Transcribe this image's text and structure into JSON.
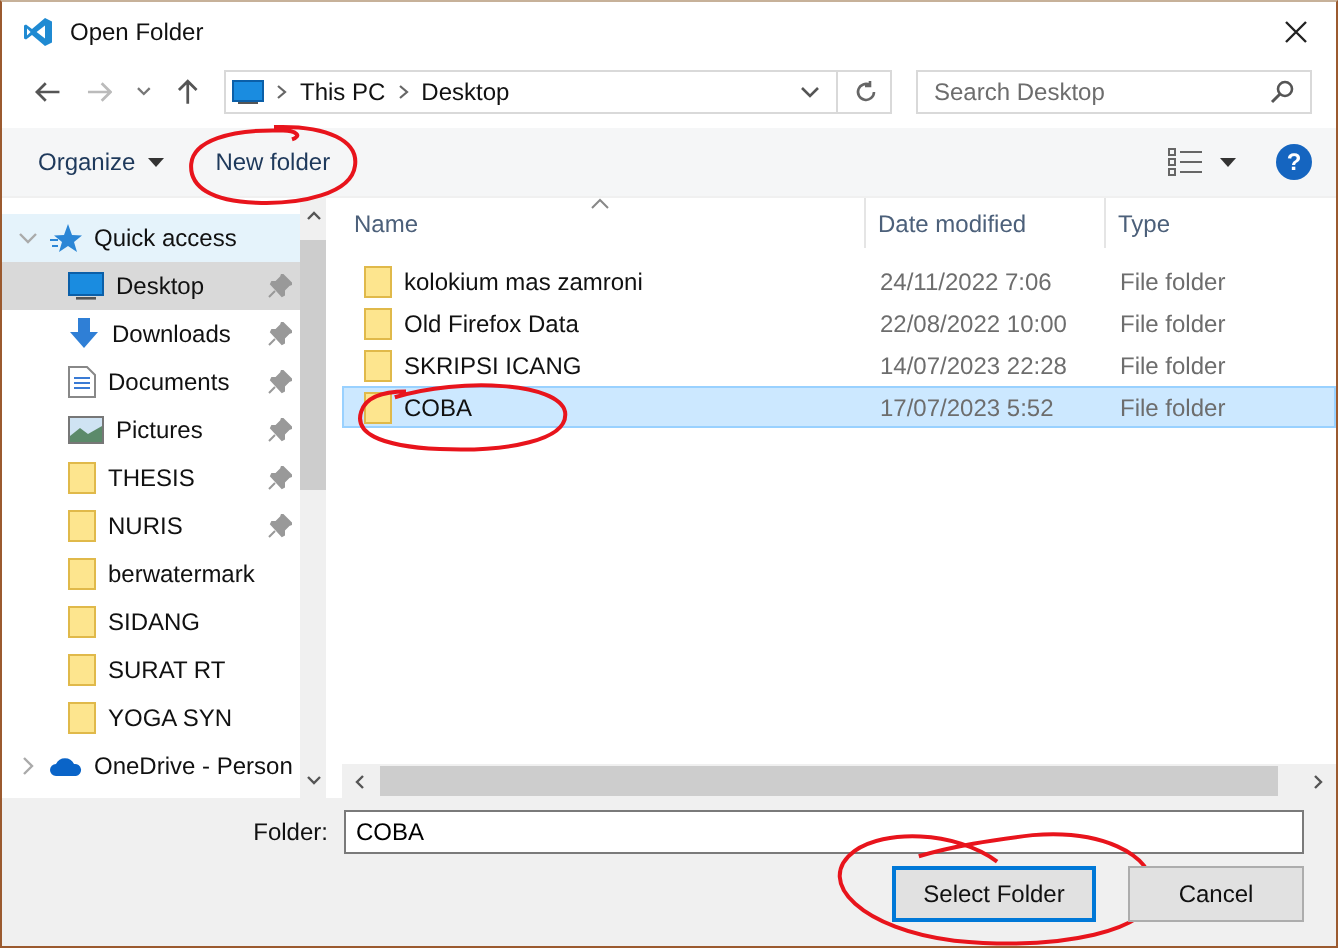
{
  "window": {
    "title": "Open Folder"
  },
  "nav": {
    "path": [
      "This PC",
      "Desktop"
    ],
    "search_placeholder": "Search Desktop"
  },
  "toolbar": {
    "organize": "Organize",
    "new_folder": {
      "label": "New folder",
      "circled": true
    },
    "help": "?"
  },
  "sidebar": [
    {
      "kind": "quick",
      "label": "Quick access",
      "expanded": true,
      "hovered": true,
      "children": [
        {
          "kind": "desktop",
          "label": "Desktop",
          "pinned": true,
          "selected": true
        },
        {
          "kind": "downloads",
          "label": "Downloads",
          "pinned": true,
          "selected": false
        },
        {
          "kind": "documents",
          "label": "Documents",
          "pinned": true,
          "selected": false
        },
        {
          "kind": "pictures",
          "label": "Pictures",
          "pinned": true,
          "selected": false
        },
        {
          "kind": "folder",
          "label": "THESIS",
          "pinned": true,
          "selected": false
        },
        {
          "kind": "folder",
          "label": "NURIS",
          "pinned": true,
          "selected": false
        },
        {
          "kind": "folder",
          "label": "berwatermark",
          "pinned": false,
          "selected": false
        },
        {
          "kind": "folder",
          "label": "SIDANG",
          "pinned": false,
          "selected": false
        },
        {
          "kind": "folder",
          "label": "SURAT RT",
          "pinned": false,
          "selected": false
        },
        {
          "kind": "folder",
          "label": "YOGA SYN",
          "pinned": false,
          "selected": false
        }
      ]
    },
    {
      "kind": "cloud",
      "label": "OneDrive - Person",
      "expanded": false,
      "hovered": false
    }
  ],
  "table": {
    "columns": [
      "Name",
      "Date modified",
      "Type"
    ],
    "rows": [
      {
        "name": "kolokium mas zamroni",
        "date": "24/11/2022 7:06",
        "type": "File folder",
        "selected": false,
        "circled": false
      },
      {
        "name": "Old Firefox Data",
        "date": "22/08/2022 10:00",
        "type": "File folder",
        "selected": false,
        "circled": false
      },
      {
        "name": "SKRIPSI ICANG",
        "date": "14/07/2023 22:28",
        "type": "File folder",
        "selected": false,
        "circled": false
      },
      {
        "name": "COBA",
        "date": "17/07/2023 5:52",
        "type": "File folder",
        "selected": true,
        "circled": true
      }
    ]
  },
  "folder_field": {
    "label": "Folder:",
    "value": "COBA"
  },
  "buttons": [
    {
      "label": "Select Folder",
      "default": true,
      "circled": true
    },
    {
      "label": "Cancel",
      "default": false,
      "circled": false
    }
  ]
}
